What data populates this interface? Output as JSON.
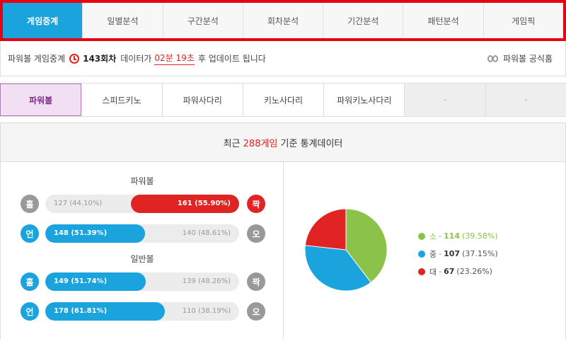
{
  "top_tabs": [
    {
      "label": "게임중계",
      "active": true
    },
    {
      "label": "일별분석"
    },
    {
      "label": "구간분석"
    },
    {
      "label": "회차분석"
    },
    {
      "label": "기간분석"
    },
    {
      "label": "패턴분석"
    },
    {
      "label": "게임픽"
    }
  ],
  "info": {
    "prefix": "파워볼 게임중계",
    "round": "143회차",
    "mid": "데이터가",
    "timer": "02분 19초",
    "suffix": "후 업데이트 됩니다",
    "official_link": "파워볼 공식홈"
  },
  "game_tabs": [
    {
      "label": "파워볼",
      "active": true
    },
    {
      "label": "스피드키노"
    },
    {
      "label": "파워사다리"
    },
    {
      "label": "키노사다리"
    },
    {
      "label": "파워키노사다리"
    },
    {
      "label": "-",
      "disabled": true
    },
    {
      "label": "-",
      "disabled": true
    }
  ],
  "stats_header": {
    "prefix": "최근",
    "count": "288게임",
    "suffix": "기준 통계데이터"
  },
  "sections": [
    {
      "title": "파워볼",
      "rows": [
        {
          "left_badge": "홀",
          "left_text": "127 (44.10%)",
          "right_text": "161 (55.90%)",
          "right_badge": "짝",
          "highlight": "right",
          "percent": 55.9
        },
        {
          "left_badge": "언",
          "left_text": "148 (51.39%)",
          "right_text": "140 (48.61%)",
          "right_badge": "오",
          "highlight": "left",
          "percent": 51.39
        }
      ]
    },
    {
      "title": "일반볼",
      "rows": [
        {
          "left_badge": "홀",
          "left_text": "149 (51.74%)",
          "right_text": "139 (48.26%)",
          "right_badge": "짝",
          "highlight": "left",
          "percent": 51.74
        },
        {
          "left_badge": "언",
          "left_text": "178 (61.81%)",
          "right_text": "110 (38.19%)",
          "right_badge": "오",
          "highlight": "left",
          "percent": 61.81
        }
      ]
    }
  ],
  "pie": {
    "legend": [
      {
        "label": "소",
        "count": "114",
        "pct": "(39.58%)",
        "color": "#8bc34a"
      },
      {
        "label": "중",
        "count": "107",
        "pct": "(37.15%)",
        "color": "#1aa3dd"
      },
      {
        "label": "대",
        "count": "67",
        "pct": "(23.26%)",
        "color": "#e02424"
      }
    ]
  },
  "chart_data": {
    "type": "pie",
    "categories": [
      "소",
      "중",
      "대"
    ],
    "values": [
      114,
      107,
      67
    ],
    "percents": [
      39.58,
      37.15,
      23.26
    ],
    "colors": [
      "#8bc34a",
      "#1aa3dd",
      "#e02424"
    ]
  }
}
